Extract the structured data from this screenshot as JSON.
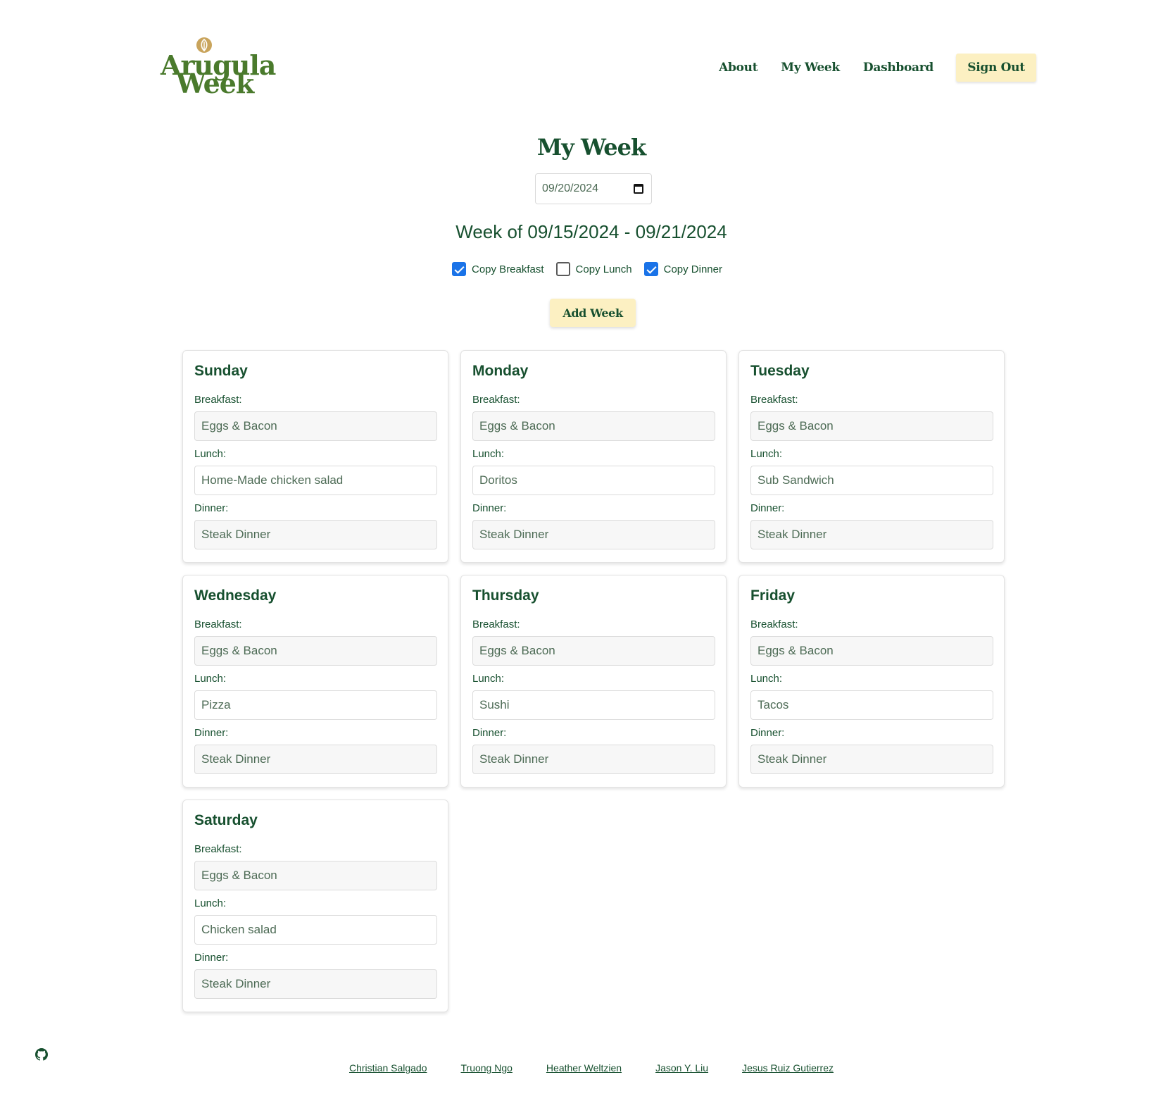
{
  "header": {
    "logo_line1": "Arugula",
    "logo_line2": "Week",
    "nav": [
      "About",
      "My Week",
      "Dashboard"
    ],
    "signout_label": "Sign Out"
  },
  "main": {
    "title": "My Week",
    "date_value": "09/20/2024",
    "week_range": "Week of 09/15/2024 - 09/21/2024",
    "copy_options": [
      {
        "label": "Copy Breakfast",
        "checked": true
      },
      {
        "label": "Copy Lunch",
        "checked": false
      },
      {
        "label": "Copy Dinner",
        "checked": true
      }
    ],
    "add_week_label": "Add Week",
    "meal_labels": {
      "breakfast": "Breakfast:",
      "lunch": "Lunch:",
      "dinner": "Dinner:"
    },
    "days": [
      {
        "name": "Sunday",
        "breakfast": "Eggs & Bacon",
        "lunch": "Home-Made chicken salad",
        "dinner": "Steak Dinner"
      },
      {
        "name": "Monday",
        "breakfast": "Eggs & Bacon",
        "lunch": "Doritos",
        "dinner": "Steak Dinner"
      },
      {
        "name": "Tuesday",
        "breakfast": "Eggs & Bacon",
        "lunch": "Sub Sandwich",
        "dinner": "Steak Dinner"
      },
      {
        "name": "Wednesday",
        "breakfast": "Eggs & Bacon",
        "lunch": "Pizza",
        "dinner": "Steak Dinner"
      },
      {
        "name": "Thursday",
        "breakfast": "Eggs & Bacon",
        "lunch": "Sushi",
        "dinner": "Steak Dinner"
      },
      {
        "name": "Friday",
        "breakfast": "Eggs & Bacon",
        "lunch": "Tacos",
        "dinner": "Steak Dinner"
      },
      {
        "name": "Saturday",
        "breakfast": "Eggs & Bacon",
        "lunch": "Chicken salad",
        "dinner": "Steak Dinner"
      }
    ]
  },
  "footer": {
    "links": [
      "Christian Salgado",
      "Truong Ngo",
      "Heather Weltzien",
      "Jason Y. Liu",
      "Jesus Ruiz Gutierrez"
    ]
  },
  "colors": {
    "primary": "#17502f",
    "accent": "#fcf0c2",
    "logo": "#4a7a2c",
    "logo_leaf": "#c9a45c",
    "checkbox": "#1a73e8"
  }
}
